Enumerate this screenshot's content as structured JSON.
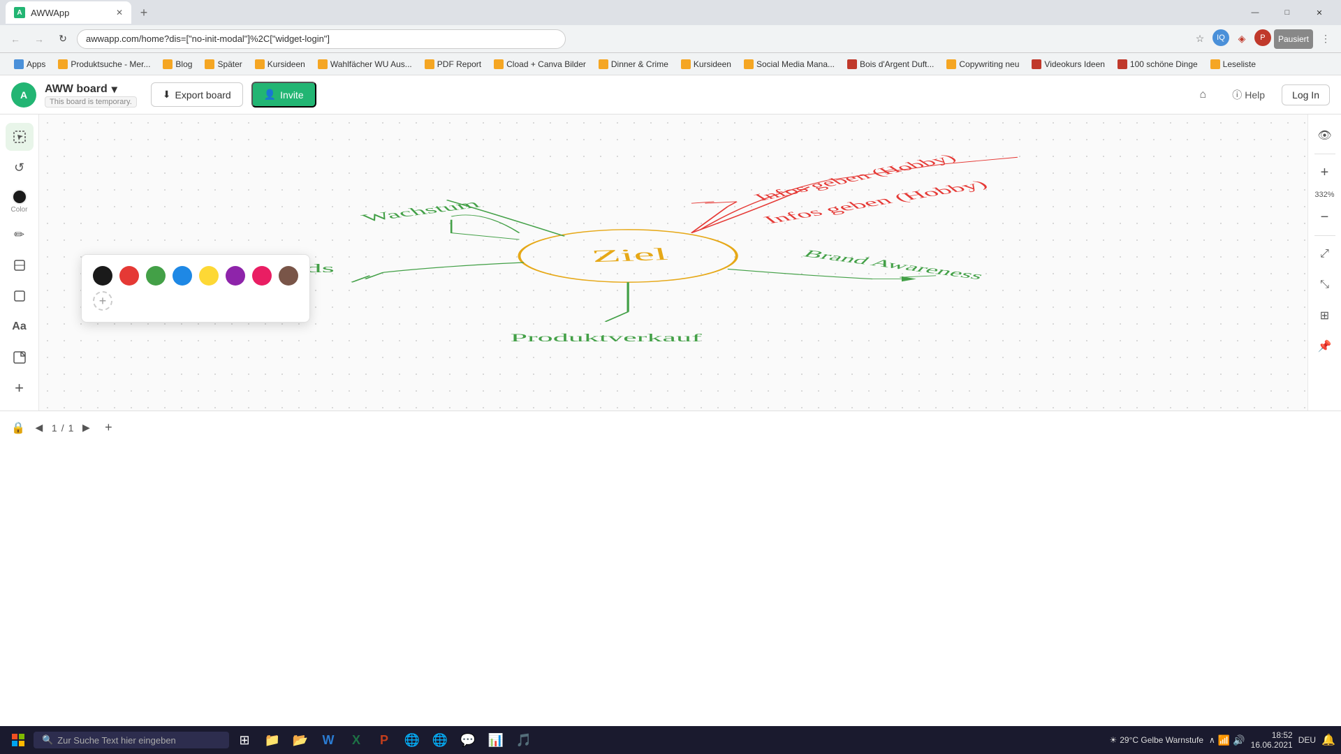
{
  "browser": {
    "tab_title": "AWWApp",
    "tab_favicon": "A",
    "address": "awwapp.com/home?dis=[\"no-init-modal\"]%2C[\"widget-login\"]",
    "new_tab_label": "+",
    "bookmarks": [
      {
        "label": "Apps",
        "type": "text"
      },
      {
        "label": "Produktsuche - Mer...",
        "type": "folder"
      },
      {
        "label": "Blog",
        "type": "folder"
      },
      {
        "label": "Später",
        "type": "folder"
      },
      {
        "label": "Kursideen",
        "type": "folder"
      },
      {
        "label": "Wahlfächer WU Aus...",
        "type": "folder"
      },
      {
        "label": "PDF Report",
        "type": "folder"
      },
      {
        "label": "Cload + Canva Bilder",
        "type": "folder"
      },
      {
        "label": "Dinner & Crime",
        "type": "folder"
      },
      {
        "label": "Kursideen",
        "type": "folder"
      },
      {
        "label": "Social Media Mana...",
        "type": "folder"
      },
      {
        "label": "Bois d'Argent Duft...",
        "type": "folder"
      },
      {
        "label": "Copywriting neu",
        "type": "folder"
      },
      {
        "label": "Videokurs Ideen",
        "type": "folder"
      },
      {
        "label": "100 schöne Dinge",
        "type": "folder"
      },
      {
        "label": "Leseliste",
        "type": "folder"
      }
    ],
    "window_controls": [
      "—",
      "□",
      "✕"
    ]
  },
  "header": {
    "logo_text": "A",
    "board_name": "AWW board",
    "board_temp_label": "This board is temporary.",
    "dropdown_icon": "▾",
    "export_button": "Export board",
    "export_icon": "⬇",
    "invite_button": "Invite",
    "invite_icon": "👤",
    "home_icon": "⌂",
    "help_label": "Help",
    "help_icon": "ⓘ",
    "login_label": "Log In"
  },
  "toolbar": {
    "tools": [
      {
        "name": "select",
        "icon": "⬚",
        "label": ""
      },
      {
        "name": "undo",
        "icon": "↺",
        "label": ""
      },
      {
        "name": "color",
        "icon": "●",
        "label": "Color"
      },
      {
        "name": "pen",
        "icon": "✏",
        "label": ""
      },
      {
        "name": "eraser",
        "icon": "◻",
        "label": ""
      },
      {
        "name": "shape",
        "icon": "□",
        "label": ""
      },
      {
        "name": "text",
        "icon": "Aa",
        "label": ""
      },
      {
        "name": "sticky",
        "icon": "◱",
        "label": ""
      },
      {
        "name": "add",
        "icon": "+",
        "label": ""
      }
    ]
  },
  "color_picker": {
    "colors": [
      "#1a1a1a",
      "#e53935",
      "#43a047",
      "#1e88e5",
      "#fdd835",
      "#8e24aa",
      "#e91e63",
      "#795548"
    ],
    "add_label": "+"
  },
  "right_toolbar": {
    "eye_icon": "👁",
    "zoom_level": "332%",
    "zoom_in": "+",
    "zoom_out": "−",
    "fit_icon": "⤢",
    "move_icon": "⤡",
    "fit2_icon": "⊞",
    "pin_icon": "📌"
  },
  "canvas": {
    "drawing_description": "Mind map with Ziel in center, branches: Wachstum, Leads, Produktverkauf, Brand Awareness, Infos geben (Hobby)"
  },
  "bottom_bar": {
    "lock_icon": "🔒",
    "prev_icon": "◀",
    "page_current": "1",
    "page_sep": "/",
    "page_total": "1",
    "next_icon": "▶",
    "add_page": "+"
  },
  "taskbar": {
    "search_placeholder": "Zur Suche Text hier eingeben",
    "weather": "29°C  Gelbe Warnstufe",
    "time": "18:52",
    "date": "16.06.2021",
    "language": "DEU",
    "taskbar_apps": [
      "⊞",
      "🔍",
      "📁",
      "📂",
      "W",
      "X",
      "P",
      "🎵",
      "🌐",
      "📧",
      "🖥",
      "🎵"
    ]
  }
}
